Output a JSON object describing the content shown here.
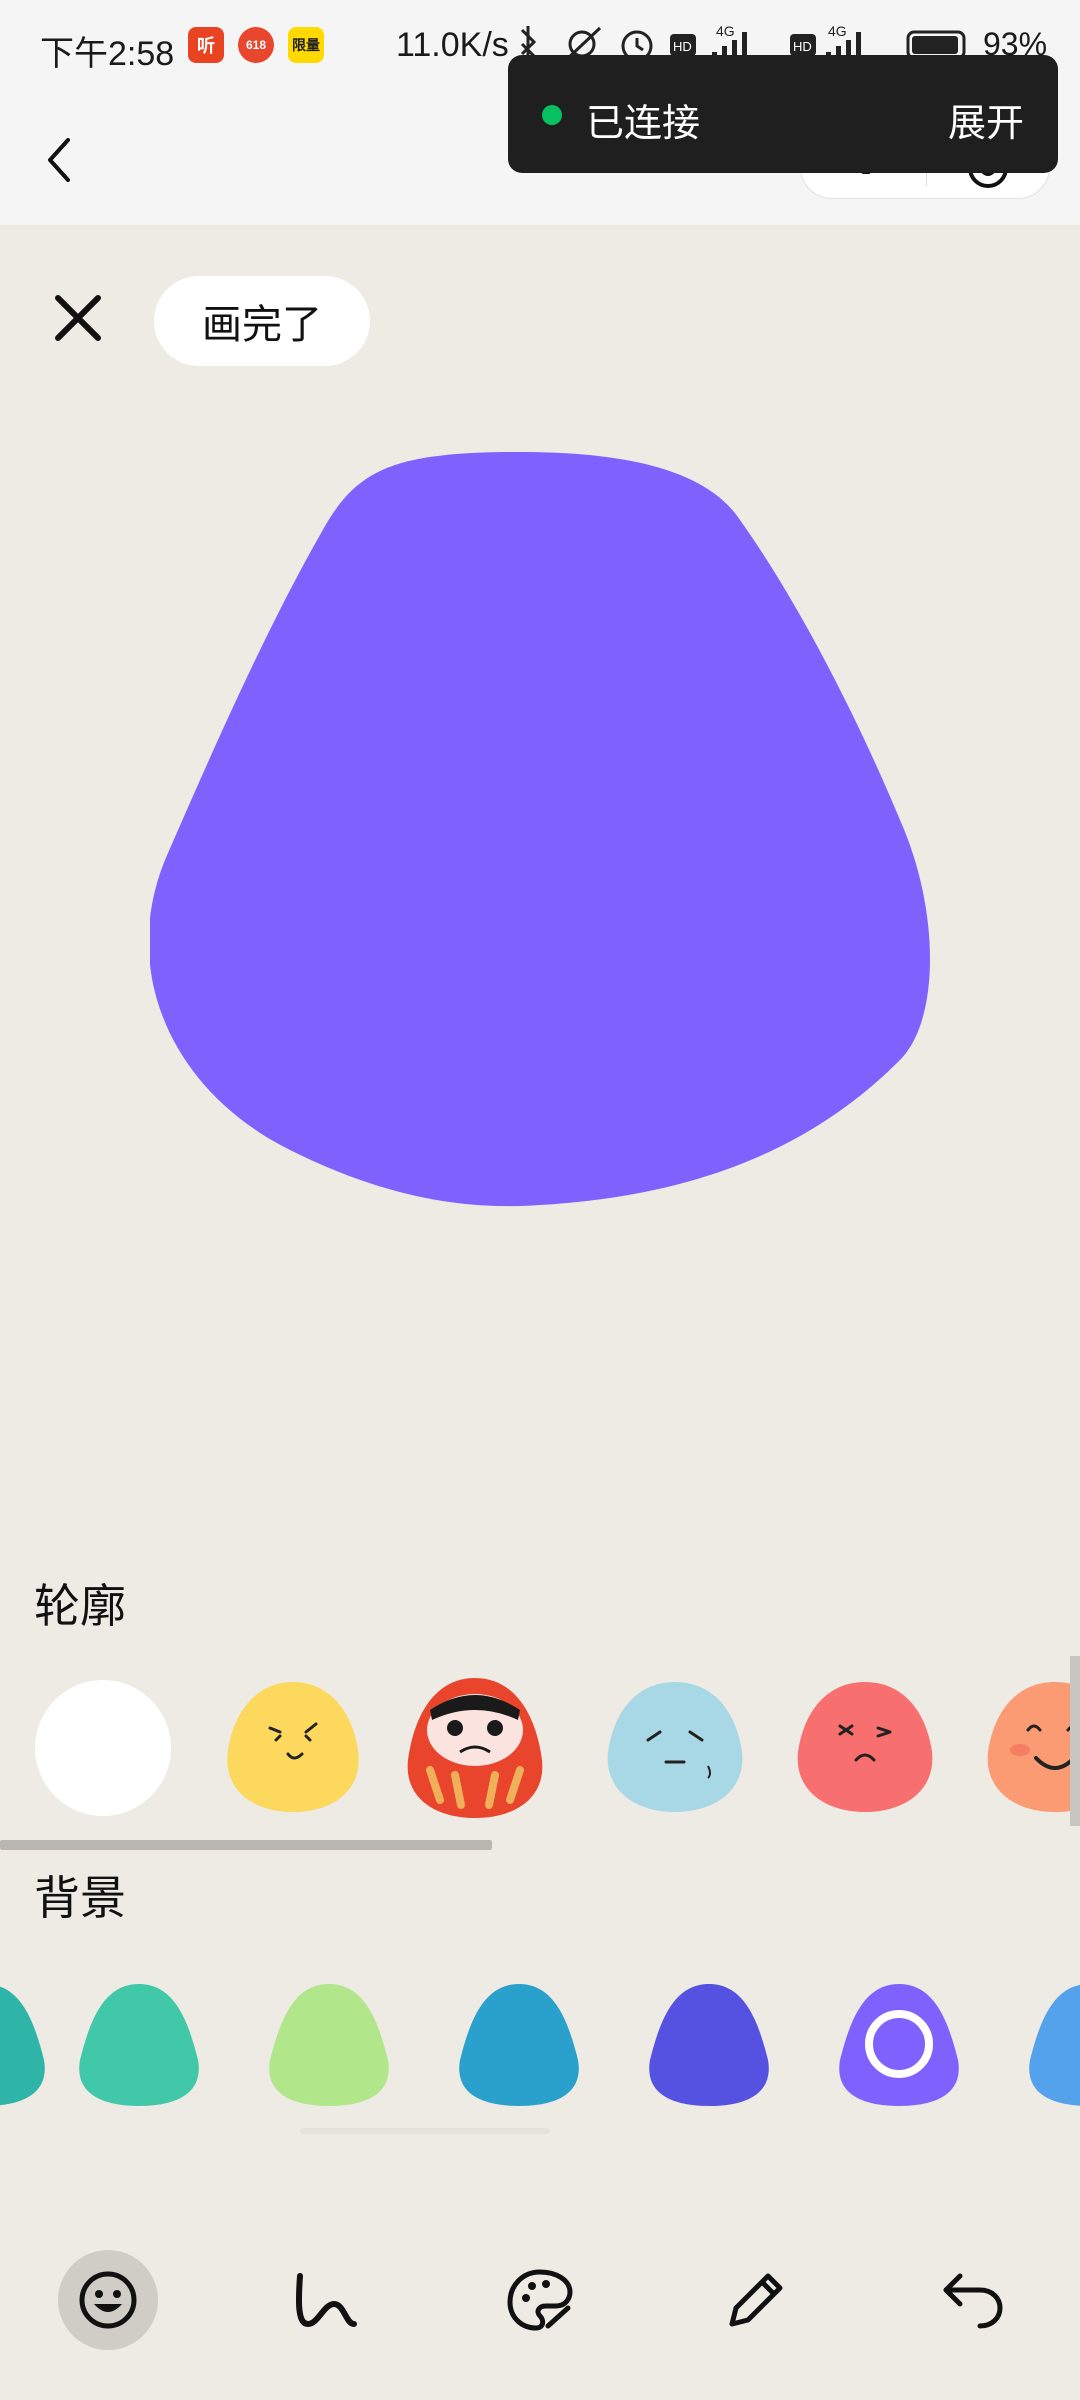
{
  "status_bar": {
    "time": "下午2:58",
    "app_icons": [
      "听",
      "618",
      "限量"
    ],
    "network_speed": "11.0K/s",
    "battery": "93%"
  },
  "header": {
    "back_icon": "chevron-left-icon",
    "capsule_icons": [
      "more-dots-icon",
      "target-close-icon"
    ]
  },
  "toast": {
    "status": "已连接",
    "expand": "展开"
  },
  "editor": {
    "close_icon": "close-icon",
    "done_label": "画完了",
    "blob_color": "#7f62fd"
  },
  "outline": {
    "title": "轮廓",
    "items": [
      "blank-face",
      "yellow-smirk-face",
      "daruma-face",
      "blue-sad-face",
      "red-angry-face",
      "orange-smile-face"
    ]
  },
  "background": {
    "title": "背景",
    "colors": [
      "#2eb5a8",
      "#41c8a8",
      "#b2e68b",
      "#2aa0cc",
      "#5552e2",
      "#7f62fd",
      "#55a2ec"
    ],
    "selected_index": 5
  },
  "bottom_toolbar": {
    "tools": [
      "emoji-icon",
      "curve-icon",
      "palette-icon",
      "pencil-icon",
      "undo-icon"
    ],
    "active": "emoji-icon"
  }
}
